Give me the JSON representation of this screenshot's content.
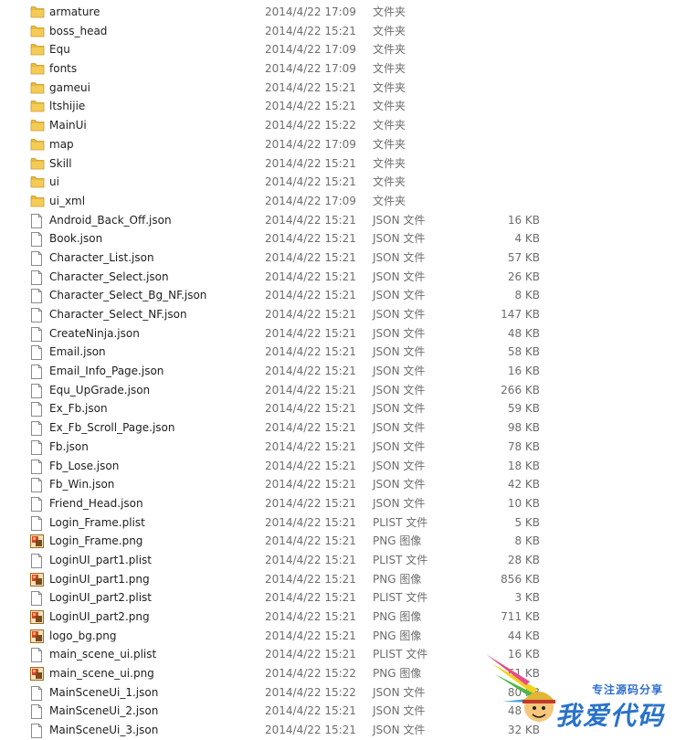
{
  "files": [
    {
      "name": "armature",
      "date": "2014/4/22 17:09",
      "type": "文件夹",
      "size": "",
      "icon": "folder-icon"
    },
    {
      "name": "boss_head",
      "date": "2014/4/22 15:21",
      "type": "文件夹",
      "size": "",
      "icon": "folder-icon"
    },
    {
      "name": "Equ",
      "date": "2014/4/22 17:09",
      "type": "文件夹",
      "size": "",
      "icon": "folder-icon"
    },
    {
      "name": "fonts",
      "date": "2014/4/22 17:09",
      "type": "文件夹",
      "size": "",
      "icon": "folder-icon"
    },
    {
      "name": "gameui",
      "date": "2014/4/22 15:21",
      "type": "文件夹",
      "size": "",
      "icon": "folder-icon"
    },
    {
      "name": "ltshijie",
      "date": "2014/4/22 15:21",
      "type": "文件夹",
      "size": "",
      "icon": "folder-icon"
    },
    {
      "name": "MainUi",
      "date": "2014/4/22 15:22",
      "type": "文件夹",
      "size": "",
      "icon": "folder-icon"
    },
    {
      "name": "map",
      "date": "2014/4/22 17:09",
      "type": "文件夹",
      "size": "",
      "icon": "folder-icon"
    },
    {
      "name": "Skill",
      "date": "2014/4/22 15:21",
      "type": "文件夹",
      "size": "",
      "icon": "folder-icon"
    },
    {
      "name": "ui",
      "date": "2014/4/22 15:21",
      "type": "文件夹",
      "size": "",
      "icon": "folder-icon"
    },
    {
      "name": "ui_xml",
      "date": "2014/4/22 17:09",
      "type": "文件夹",
      "size": "",
      "icon": "folder-icon"
    },
    {
      "name": "Android_Back_Off.json",
      "date": "2014/4/22 15:21",
      "type": "JSON 文件",
      "size": "16 KB",
      "icon": "document-icon"
    },
    {
      "name": "Book.json",
      "date": "2014/4/22 15:21",
      "type": "JSON 文件",
      "size": "4 KB",
      "icon": "document-icon"
    },
    {
      "name": "Character_List.json",
      "date": "2014/4/22 15:21",
      "type": "JSON 文件",
      "size": "57 KB",
      "icon": "document-icon"
    },
    {
      "name": "Character_Select.json",
      "date": "2014/4/22 15:21",
      "type": "JSON 文件",
      "size": "26 KB",
      "icon": "document-icon"
    },
    {
      "name": "Character_Select_Bg_NF.json",
      "date": "2014/4/22 15:21",
      "type": "JSON 文件",
      "size": "8 KB",
      "icon": "document-icon"
    },
    {
      "name": "Character_Select_NF.json",
      "date": "2014/4/22 15:21",
      "type": "JSON 文件",
      "size": "147 KB",
      "icon": "document-icon"
    },
    {
      "name": "CreateNinja.json",
      "date": "2014/4/22 15:21",
      "type": "JSON 文件",
      "size": "48 KB",
      "icon": "document-icon"
    },
    {
      "name": "Email.json",
      "date": "2014/4/22 15:21",
      "type": "JSON 文件",
      "size": "58 KB",
      "icon": "document-icon"
    },
    {
      "name": "Email_Info_Page.json",
      "date": "2014/4/22 15:21",
      "type": "JSON 文件",
      "size": "16 KB",
      "icon": "document-icon"
    },
    {
      "name": "Equ_UpGrade.json",
      "date": "2014/4/22 15:21",
      "type": "JSON 文件",
      "size": "266 KB",
      "icon": "document-icon"
    },
    {
      "name": "Ex_Fb.json",
      "date": "2014/4/22 15:21",
      "type": "JSON 文件",
      "size": "59 KB",
      "icon": "document-icon"
    },
    {
      "name": "Ex_Fb_Scroll_Page.json",
      "date": "2014/4/22 15:21",
      "type": "JSON 文件",
      "size": "98 KB",
      "icon": "document-icon"
    },
    {
      "name": "Fb.json",
      "date": "2014/4/22 15:21",
      "type": "JSON 文件",
      "size": "78 KB",
      "icon": "document-icon"
    },
    {
      "name": "Fb_Lose.json",
      "date": "2014/4/22 15:21",
      "type": "JSON 文件",
      "size": "18 KB",
      "icon": "document-icon"
    },
    {
      "name": "Fb_Win.json",
      "date": "2014/4/22 15:21",
      "type": "JSON 文件",
      "size": "42 KB",
      "icon": "document-icon"
    },
    {
      "name": "Friend_Head.json",
      "date": "2014/4/22 15:21",
      "type": "JSON 文件",
      "size": "10 KB",
      "icon": "document-icon"
    },
    {
      "name": "Login_Frame.plist",
      "date": "2014/4/22 15:21",
      "type": "PLIST 文件",
      "size": "5 KB",
      "icon": "document-icon"
    },
    {
      "name": "Login_Frame.png",
      "date": "2014/4/22 15:21",
      "type": "PNG 图像",
      "size": "8 KB",
      "icon": "image-icon"
    },
    {
      "name": "LoginUI_part1.plist",
      "date": "2014/4/22 15:21",
      "type": "PLIST 文件",
      "size": "28 KB",
      "icon": "document-icon"
    },
    {
      "name": "LoginUI_part1.png",
      "date": "2014/4/22 15:21",
      "type": "PNG 图像",
      "size": "856 KB",
      "icon": "image-icon"
    },
    {
      "name": "LoginUI_part2.plist",
      "date": "2014/4/22 15:21",
      "type": "PLIST 文件",
      "size": "3 KB",
      "icon": "document-icon"
    },
    {
      "name": "LoginUI_part2.png",
      "date": "2014/4/22 15:21",
      "type": "PNG 图像",
      "size": "711 KB",
      "icon": "image-icon"
    },
    {
      "name": "logo_bg.png",
      "date": "2014/4/22 15:21",
      "type": "PNG 图像",
      "size": "44 KB",
      "icon": "image-icon"
    },
    {
      "name": "main_scene_ui.plist",
      "date": "2014/4/22 15:21",
      "type": "PLIST 文件",
      "size": "16 KB",
      "icon": "document-icon"
    },
    {
      "name": "main_scene_ui.png",
      "date": "2014/4/22 15:22",
      "type": "PNG 图像",
      "size": "61 KB",
      "icon": "image-icon"
    },
    {
      "name": "MainSceneUi_1.json",
      "date": "2014/4/22 15:22",
      "type": "JSON 文件",
      "size": "80 KB",
      "icon": "document-icon"
    },
    {
      "name": "MainSceneUi_2.json",
      "date": "2014/4/22 15:21",
      "type": "JSON 文件",
      "size": "48 KB",
      "icon": "document-icon"
    },
    {
      "name": "MainSceneUi_3.json",
      "date": "2014/4/22 15:21",
      "type": "JSON 文件",
      "size": "32 KB",
      "icon": "document-icon"
    }
  ],
  "watermark": {
    "caption": "专注源码分享",
    "main": "我爱代码"
  },
  "colors": {
    "folder": "#e8b93c",
    "name_text": "#1e1e1e",
    "meta_text": "#6d6d6d",
    "watermark_blue": "#2a73c9"
  }
}
